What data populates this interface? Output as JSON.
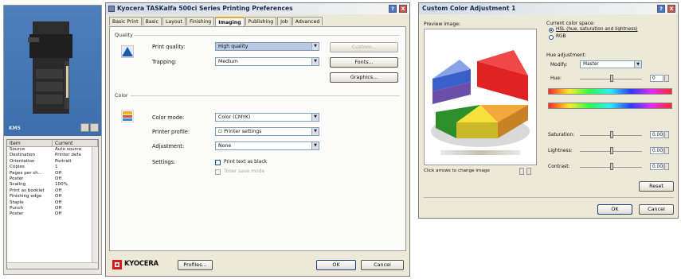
{
  "left_panel": {
    "model": "KM5",
    "table": {
      "headers": [
        "Item",
        "Current"
      ],
      "rows": [
        [
          "Source",
          "Auto source"
        ],
        [
          "Destination",
          "Printer defa"
        ],
        [
          "Orientation",
          "Portrait"
        ],
        [
          "Copies",
          "1"
        ],
        [
          "Pages per sh...",
          "Off"
        ],
        [
          "Poster",
          "Off"
        ],
        [
          "Scaling",
          "100%"
        ],
        [
          "Print as booklet",
          "Off"
        ],
        [
          "Finishing edge",
          "Off"
        ],
        [
          "Staple",
          "Off"
        ],
        [
          "Punch",
          "Off"
        ],
        [
          "Poster",
          "Off"
        ]
      ]
    }
  },
  "main_dialog": {
    "title": "Kyocera TASKalfa 500ci Series Printing Preferences",
    "title_buttons": [
      "?",
      "X"
    ],
    "tabs": [
      "Basic Print",
      "Basic",
      "Layout",
      "Finishing",
      "Imaging",
      "Publishing",
      "Job",
      "Advanced"
    ],
    "active_tab": "Imaging",
    "quality_group": "Quality",
    "print_quality_label": "Print quality:",
    "print_quality_value": "High quality",
    "trapping_label": "Trapping:",
    "trapping_value": "Medium",
    "custom_button": "Custom...",
    "fonts_button": "Fonts...",
    "graphics_button": "Graphics...",
    "color_group": "Color",
    "color_mode_label": "Color mode:",
    "color_mode_value": "Color (CMYK)",
    "printer_profile_label": "Printer profile:",
    "printer_profile_value": "Printer settings",
    "adjustment_label": "Adjustment:",
    "adjustment_value": "None",
    "settings_label": "Settings:",
    "print_black_label": "Print text as black",
    "toner_save_label": "Toner save mode",
    "brand": "KYOCERA",
    "profiles_button": "Profiles...",
    "ok_button": "OK",
    "cancel_button": "Cancel"
  },
  "color_dialog": {
    "title": "Custom Color Adjustment 1",
    "title_buttons": [
      "?",
      "X"
    ],
    "preview_label": "Preview image:",
    "arrows_hint": "Click arrows to change image",
    "color_space_label": "Current color space:",
    "hsl_option": "HSL (hue, saturation and lightness)",
    "rgb_option": "RGB",
    "hue_adjustment_label": "Hue adjustment:",
    "modify_label": "Modify:",
    "modify_value": "Master",
    "hue_label": "Hue:",
    "hue_value": "0",
    "saturation_label": "Saturation:",
    "saturation_value": "0.00",
    "lightness_label": "Lightness:",
    "lightness_value": "0.00",
    "contrast_label": "Contrast:",
    "contrast_value": "0.00",
    "reset_button": "Reset",
    "ok_button": "OK",
    "cancel_button": "Cancel"
  }
}
